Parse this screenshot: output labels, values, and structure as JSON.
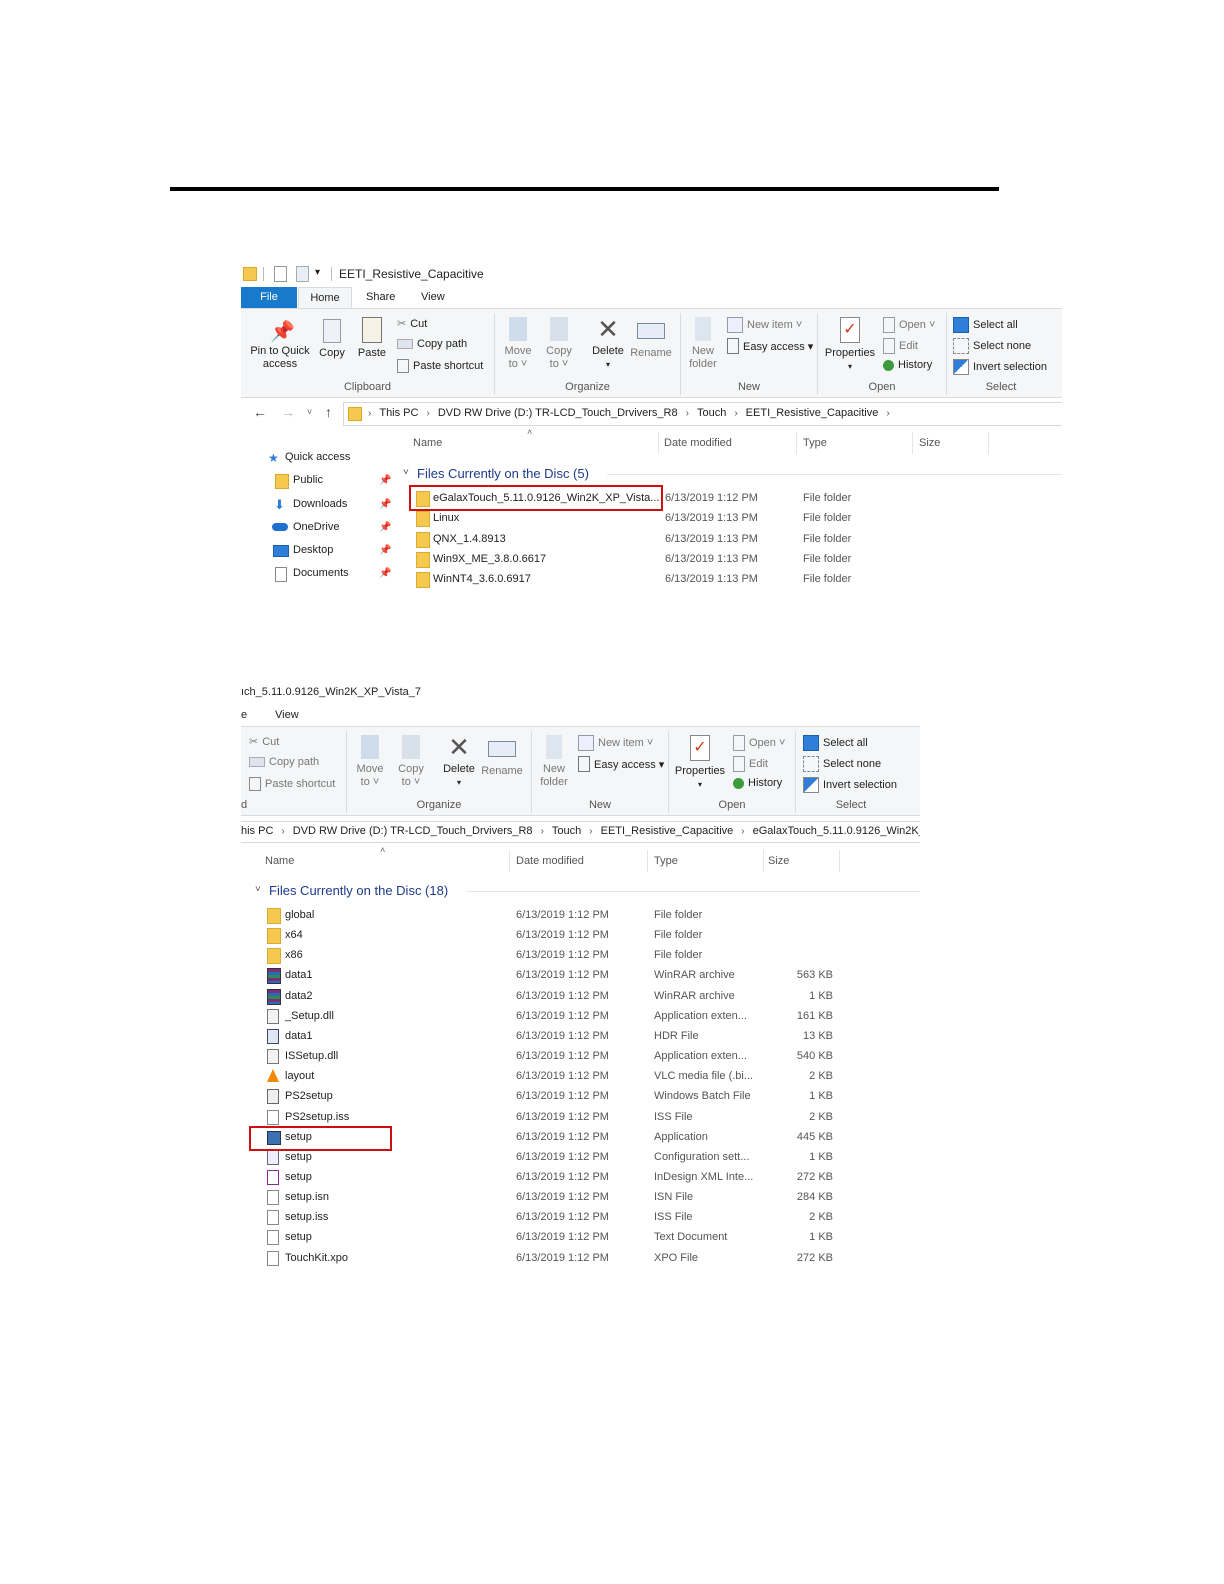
{
  "window1": {
    "title": "EETI_Resistive_Capacitive",
    "tabs": [
      "File",
      "Home",
      "Share",
      "View"
    ],
    "clipboard": {
      "pin_line1": "Pin to Quick",
      "pin_line2": "access",
      "copy": "Copy",
      "paste": "Paste",
      "cut": "Cut",
      "copy_path": "Copy path",
      "paste_shortcut": "Paste shortcut",
      "label": "Clipboard"
    },
    "organize": {
      "move_line1": "Move",
      "move_line2": "to ˅",
      "copy_line1": "Copy",
      "copy_line2": "to ˅",
      "delete": "Delete",
      "rename": "Rename",
      "label": "Organize"
    },
    "new_group": {
      "new_folder_line1": "New",
      "new_folder_line2": "folder",
      "new_item": "New item ˅",
      "easy_access": "Easy access ▾",
      "label": "New"
    },
    "open_group": {
      "properties": "Properties",
      "open": "Open ˅",
      "edit": "Edit",
      "history": "History",
      "label": "Open"
    },
    "select_group": {
      "select_all": "Select all",
      "select_none": "Select none",
      "invert_selection": "Invert selection",
      "label": "Select"
    },
    "breadcrumb": [
      "This PC",
      "DVD RW Drive (D:) TR-LCD_Touch_Drvivers_R8",
      "Touch",
      "EETI_Resistive_Capacitive"
    ],
    "nav": {
      "quick_access": "Quick access",
      "items": [
        "Public",
        "Downloads",
        "OneDrive",
        "Desktop",
        "Documents"
      ]
    },
    "columns": [
      "Name",
      "Date modified",
      "Type",
      "Size"
    ],
    "group_title": "Files Currently on the Disc (5)",
    "rows": [
      {
        "name": "eGalaxTouch_5.11.0.9126_Win2K_XP_Vista...",
        "date": "6/13/2019 1:12 PM",
        "type": "File folder",
        "size": ""
      },
      {
        "name": "Linux",
        "date": "6/13/2019 1:13 PM",
        "type": "File folder",
        "size": ""
      },
      {
        "name": "QNX_1.4.8913",
        "date": "6/13/2019 1:13 PM",
        "type": "File folder",
        "size": ""
      },
      {
        "name": "Win9X_ME_3.8.0.6617",
        "date": "6/13/2019 1:13 PM",
        "type": "File folder",
        "size": ""
      },
      {
        "name": "WinNT4_3.6.0.6917",
        "date": "6/13/2019 1:13 PM",
        "type": "File folder",
        "size": ""
      }
    ]
  },
  "window2": {
    "title": "ıch_5.11.0.9126_Win2K_XP_Vista_7",
    "tabs": [
      "e",
      "View"
    ],
    "clipboard": {
      "cut": "Cut",
      "copy_path": "Copy path",
      "paste_shortcut": "Paste shortcut",
      "edge_label": "d"
    },
    "organize": {
      "move_line1": "Move",
      "move_line2": "to ˅",
      "copy_line1": "Copy",
      "copy_line2": "to ˅",
      "delete": "Delete",
      "rename": "Rename",
      "label": "Organize"
    },
    "new_group": {
      "new_folder_line1": "New",
      "new_folder_line2": "folder",
      "new_item": "New item ˅",
      "easy_access": "Easy access ▾",
      "label": "New"
    },
    "open_group": {
      "properties": "Properties",
      "open": "Open ˅",
      "edit": "Edit",
      "history": "History",
      "label": "Open"
    },
    "select_group": {
      "select_all": "Select all",
      "select_none": "Select none",
      "invert_selection": "Invert selection",
      "label": "Select"
    },
    "breadcrumb": [
      "his PC",
      "DVD RW Drive (D:) TR-LCD_Touch_Drvivers_R8",
      "Touch",
      "EETI_Resistive_Capacitive",
      "eGalaxTouch_5.11.0.9126_Win2K_X"
    ],
    "columns": [
      "Name",
      "Date modified",
      "Type",
      "Size"
    ],
    "group_title": "Files Currently on the Disc (18)",
    "rows": [
      {
        "icon": "folder",
        "name": "global",
        "date": "6/13/2019 1:12 PM",
        "type": "File folder",
        "size": ""
      },
      {
        "icon": "folder",
        "name": "x64",
        "date": "6/13/2019 1:12 PM",
        "type": "File folder",
        "size": ""
      },
      {
        "icon": "folder",
        "name": "x86",
        "date": "6/13/2019 1:12 PM",
        "type": "File folder",
        "size": ""
      },
      {
        "icon": "rar",
        "name": "data1",
        "date": "6/13/2019 1:12 PM",
        "type": "WinRAR archive",
        "size": "563 KB"
      },
      {
        "icon": "rar",
        "name": "data2",
        "date": "6/13/2019 1:12 PM",
        "type": "WinRAR archive",
        "size": "1 KB"
      },
      {
        "icon": "dll",
        "name": "_Setup.dll",
        "date": "6/13/2019 1:12 PM",
        "type": "Application exten...",
        "size": "161 KB"
      },
      {
        "icon": "hdr",
        "name": "data1",
        "date": "6/13/2019 1:12 PM",
        "type": "HDR File",
        "size": "13 KB"
      },
      {
        "icon": "dll",
        "name": "ISSetup.dll",
        "date": "6/13/2019 1:12 PM",
        "type": "Application exten...",
        "size": "540 KB"
      },
      {
        "icon": "vlc",
        "name": "layout",
        "date": "6/13/2019 1:12 PM",
        "type": "VLC media file (.bi...",
        "size": "2 KB"
      },
      {
        "icon": "bat",
        "name": "PS2setup",
        "date": "6/13/2019 1:12 PM",
        "type": "Windows Batch File",
        "size": "1 KB"
      },
      {
        "icon": "file",
        "name": "PS2setup.iss",
        "date": "6/13/2019 1:12 PM",
        "type": "ISS File",
        "size": "2 KB"
      },
      {
        "icon": "app",
        "name": "setup",
        "date": "6/13/2019 1:12 PM",
        "type": "Application",
        "size": "445 KB"
      },
      {
        "icon": "cfg",
        "name": "setup",
        "date": "6/13/2019 1:12 PM",
        "type": "Configuration sett...",
        "size": "1 KB"
      },
      {
        "icon": "xml",
        "name": "setup",
        "date": "6/13/2019 1:12 PM",
        "type": "InDesign XML Inte...",
        "size": "272 KB"
      },
      {
        "icon": "file",
        "name": "setup.isn",
        "date": "6/13/2019 1:12 PM",
        "type": "ISN File",
        "size": "284 KB"
      },
      {
        "icon": "file",
        "name": "setup.iss",
        "date": "6/13/2019 1:12 PM",
        "type": "ISS File",
        "size": "2 KB"
      },
      {
        "icon": "file",
        "name": "setup",
        "date": "6/13/2019 1:12 PM",
        "type": "Text Document",
        "size": "1 KB"
      },
      {
        "icon": "file",
        "name": "TouchKit.xpo",
        "date": "6/13/2019 1:12 PM",
        "type": "XPO File",
        "size": "272 KB"
      }
    ]
  },
  "colors": {
    "accent": "#1979ca",
    "highlight": "#d01010",
    "folder": "#f4c94d"
  }
}
